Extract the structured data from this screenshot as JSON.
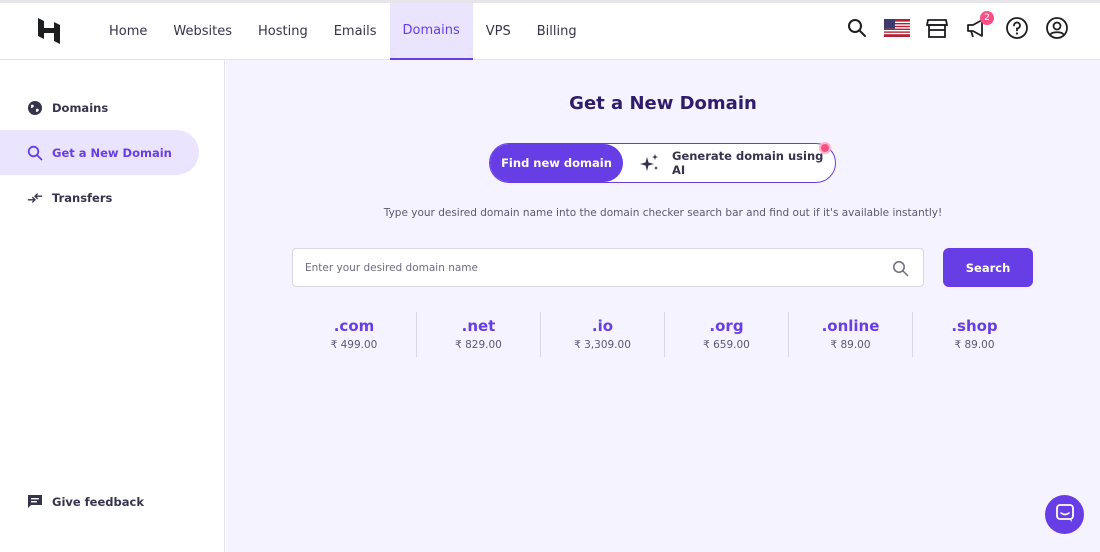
{
  "nav": {
    "items": [
      {
        "label": "Home"
      },
      {
        "label": "Websites"
      },
      {
        "label": "Hosting"
      },
      {
        "label": "Emails"
      },
      {
        "label": "Domains",
        "active": true
      },
      {
        "label": "VPS"
      },
      {
        "label": "Billing"
      }
    ],
    "notification_count": "2",
    "icons": [
      "search-icon",
      "us-flag-icon",
      "store-icon",
      "megaphone-icon",
      "help-icon",
      "account-icon"
    ]
  },
  "sidebar": {
    "items": [
      {
        "label": "Domains",
        "icon": "globe-icon"
      },
      {
        "label": "Get a New Domain",
        "icon": "search-icon",
        "active": true
      },
      {
        "label": "Transfers",
        "icon": "transfer-arrows-icon"
      }
    ],
    "feedback_label": "Give feedback"
  },
  "main": {
    "title": "Get a New Domain",
    "toggle": {
      "find_label": "Find new domain",
      "ai_label": "Generate domain using AI"
    },
    "description": "Type your desired domain name into the domain checker search bar and find out if it's available instantly!",
    "search": {
      "placeholder": "Enter your desired domain name",
      "value": "",
      "button_label": "Search"
    },
    "tlds": [
      {
        "name": ".com",
        "price": "₹ 499.00"
      },
      {
        "name": ".net",
        "price": "₹ 829.00"
      },
      {
        "name": ".io",
        "price": "₹ 3,309.00"
      },
      {
        "name": ".org",
        "price": "₹ 659.00"
      },
      {
        "name": ".online",
        "price": "₹ 89.00"
      },
      {
        "name": ".shop",
        "price": "₹ 89.00"
      }
    ]
  },
  "colors": {
    "accent": "#673de6",
    "accent_light": "#ebe4ff",
    "background": "#f4f3ff",
    "badge": "#fc5185"
  }
}
